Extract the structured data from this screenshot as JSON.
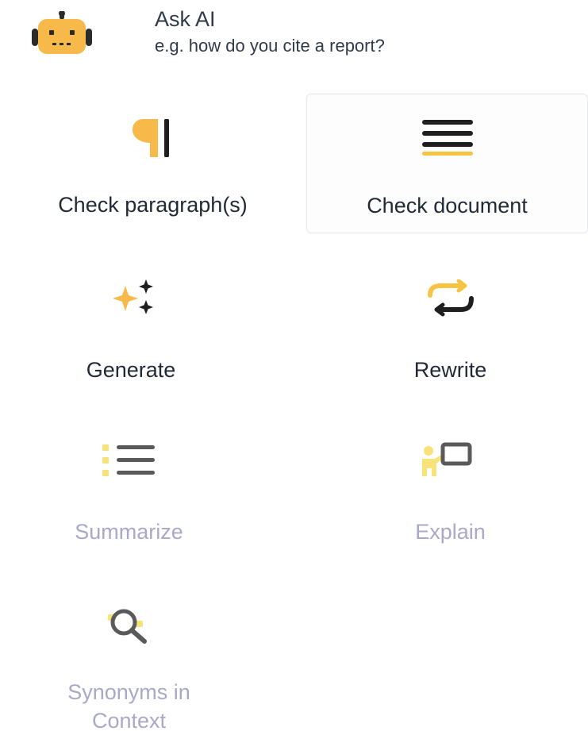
{
  "ask_ai": {
    "title": "Ask AI",
    "hint": "e.g. how do you cite a report?",
    "icon": "robot-icon"
  },
  "colors": {
    "accent_yellow": "#f6c343",
    "dark": "#1f2a36",
    "muted_label": "#a8a9c8"
  },
  "actions": [
    {
      "id": "check_paragraphs",
      "label": "Check paragraph(s)",
      "icon": "paragraph-icon",
      "enabled": true
    },
    {
      "id": "check_document",
      "label": "Check document",
      "icon": "document-lines-icon",
      "enabled": true,
      "selected": true
    },
    {
      "id": "generate",
      "label": "Generate",
      "icon": "sparkles-icon",
      "enabled": true
    },
    {
      "id": "rewrite",
      "label": "Rewrite",
      "icon": "swap-arrows-icon",
      "enabled": true
    },
    {
      "id": "summarize",
      "label": "Summarize",
      "icon": "list-icon",
      "enabled": false
    },
    {
      "id": "explain",
      "label": "Explain",
      "icon": "presenter-icon",
      "enabled": false
    },
    {
      "id": "synonyms",
      "label_line1": "Synonyms in",
      "label_line2": "Context",
      "icon": "magnifier-icon",
      "enabled": false
    }
  ]
}
